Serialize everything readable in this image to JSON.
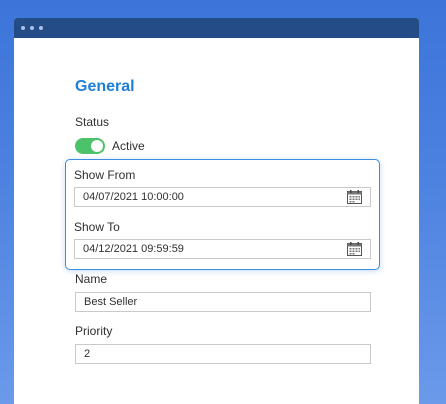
{
  "form": {
    "section_title": "General",
    "status": {
      "label": "Status",
      "toggle_state": "on",
      "toggle_label": "Active"
    },
    "show_from": {
      "label": "Show From",
      "value": "04/07/2021 10:00:00"
    },
    "show_to": {
      "label": "Show To",
      "value": "04/12/2021 09:59:59"
    },
    "name": {
      "label": "Name",
      "value": "Best Seller"
    },
    "priority": {
      "label": "Priority",
      "value": "2"
    }
  },
  "colors": {
    "accent": "#1e7fd8",
    "toggle_on": "#4cc26a",
    "titlebar": "#244c86",
    "background": "#4d82e0"
  },
  "icons": {
    "calendar": "calendar-icon"
  }
}
